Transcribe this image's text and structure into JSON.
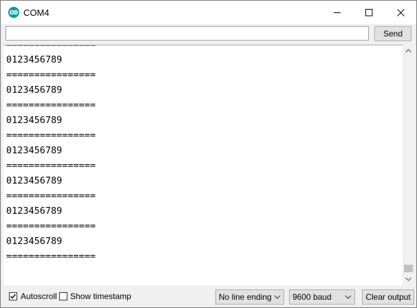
{
  "window": {
    "title": "COM4",
    "icon": "arduino-logo-icon",
    "controls": [
      "minimize-icon",
      "maximize-icon",
      "close-icon"
    ]
  },
  "input": {
    "value": "",
    "placeholder": "",
    "send_label": "Send"
  },
  "output": {
    "lines": [
      "================",
      "0123456789",
      "================",
      "0123456789",
      "================",
      "0123456789",
      "================",
      "0123456789",
      "================",
      "0123456789",
      "================",
      "0123456789",
      "================",
      "0123456789",
      "================"
    ]
  },
  "bottom": {
    "autoscroll_label": "Autoscroll",
    "autoscroll_checked": true,
    "timestamp_label": "Show timestamp",
    "timestamp_checked": false,
    "line_ending_value": "No line ending",
    "baud_value": "9600 baud",
    "clear_label": "Clear output"
  },
  "colors": {
    "accent": "#00979c"
  }
}
